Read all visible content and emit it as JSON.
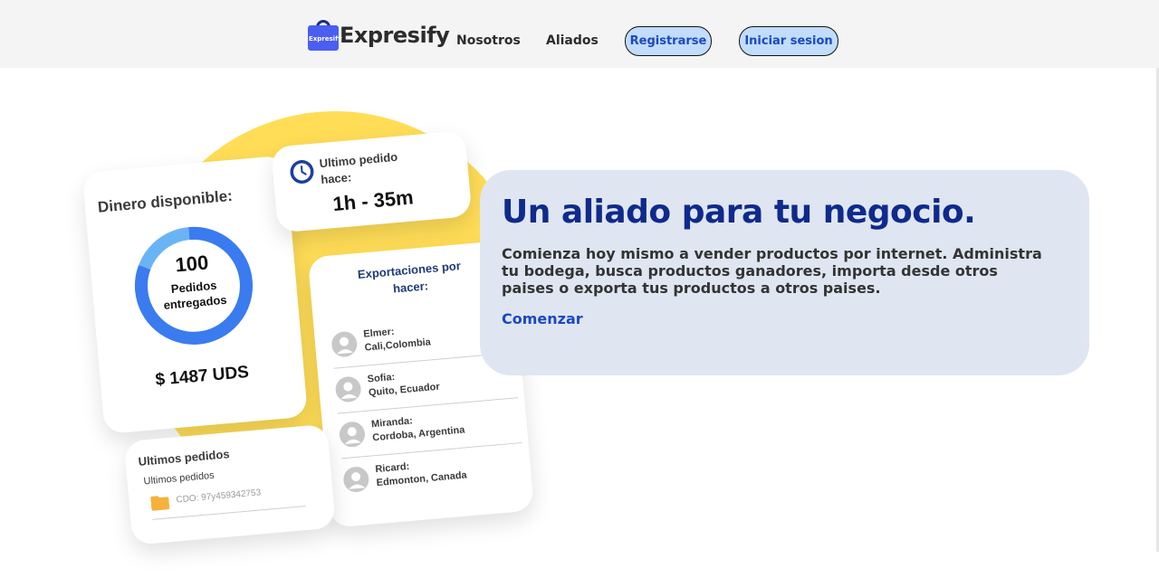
{
  "brand": {
    "name": "Expresify",
    "bag_label": "Expresify",
    "icon": "shopping-bag-icon"
  },
  "nav": {
    "links": [
      {
        "label": "Nosotros"
      },
      {
        "label": "Aliados"
      }
    ],
    "register_label": "Registrarse",
    "login_label": "Iniciar sesion"
  },
  "illustration": {
    "balance": {
      "title": "Dinero disponible:",
      "orders_count": "100",
      "orders_line1": "Pedidos",
      "orders_line2": "entregados",
      "ring_progress": 0.82,
      "amount": "$ 1487 UDS"
    },
    "last_order": {
      "title_line1": "Ultimo pedido",
      "title_line2": "hace:",
      "time": "1h - 35m",
      "icon": "clock-icon"
    },
    "exports": {
      "title_line1": "Exportaciones por",
      "title_line2": "hacer:",
      "items": [
        {
          "name": "Elmer:",
          "place": "Cali,Colombia"
        },
        {
          "name": "Sofia:",
          "place": "Quito, Ecuador"
        },
        {
          "name": "Miranda:",
          "place": "Cordoba, Argentina"
        },
        {
          "name": "Ricard:",
          "place": "Edmonton, Canada"
        }
      ]
    },
    "recent": {
      "title": "Ultimos pedidos",
      "subtitle": "Ultimos pedidos",
      "code": "CDO: 97y459342753",
      "icon": "folder-icon"
    }
  },
  "hero": {
    "title": "Un aliado para tu negocio.",
    "text": "Comienza hoy mismo a vender productos por internet. Administra tu bodega, busca productos ganadores, importa desde otros paises o exporta tus productos a otros paises.",
    "cta": "Comenzar"
  },
  "colors": {
    "accent": "#0f2a8c",
    "link": "#1b48c2",
    "pill_bg": "#c2dcfb",
    "hero_bg": "#dfe6f1",
    "yellow": "#ffdd57"
  }
}
